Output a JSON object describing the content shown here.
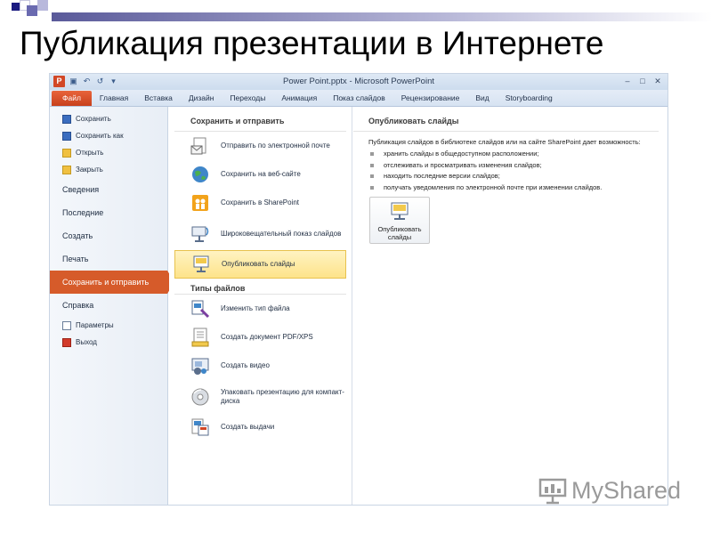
{
  "slide": {
    "title": "Публикация презентации в Интернете"
  },
  "app": {
    "window_title": "Power Point.pptx - Microsoft PowerPoint",
    "logo_letter": "P",
    "tabs": [
      "Файл",
      "Главная",
      "Вставка",
      "Дизайн",
      "Переходы",
      "Анимация",
      "Показ слайдов",
      "Рецензирование",
      "Вид",
      "Storyboarding"
    ],
    "sidebar": {
      "small_top": [
        "Сохранить",
        "Сохранить как",
        "Открыть",
        "Закрыть"
      ],
      "big": [
        "Сведения",
        "Последние",
        "Создать",
        "Печать",
        "Сохранить и отправить",
        "Справка"
      ],
      "small_bottom": [
        "Параметры",
        "Выход"
      ]
    },
    "middle": {
      "section1": "Сохранить и отправить",
      "items1": [
        "Отправить по электронной почте",
        "Сохранить на веб-сайте",
        "Сохранить в SharePoint",
        "Широковещательный показ слайдов",
        "Опубликовать слайды"
      ],
      "section2": "Типы файлов",
      "items2": [
        "Изменить тип файла",
        "Создать документ PDF/XPS",
        "Создать видео",
        "Упаковать презентацию для компакт-диска",
        "Создать выдачи"
      ]
    },
    "right": {
      "heading": "Опубликовать слайды",
      "description": "Публикация слайдов в библиотеке слайдов или на сайте SharePoint дает возможность:",
      "bullets": [
        "хранить слайды в общедоступном расположении;",
        "отслеживать и просматривать изменения слайдов;",
        "находить последние версии слайдов;",
        "получать уведомления по электронной почте при изменении слайдов."
      ],
      "button_label": "Опубликовать слайды"
    }
  },
  "watermark": "MyShared",
  "colors": {
    "file_tab": "#c8401c",
    "active_sidebar": "#d65b2a",
    "selected_item": "#fde38a",
    "slide_square": "#1a1a80"
  }
}
